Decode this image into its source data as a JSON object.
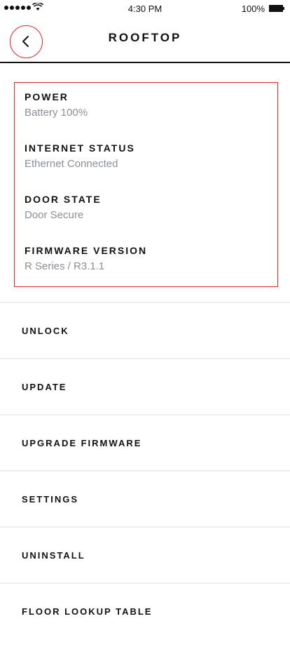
{
  "status_bar": {
    "time": "4:30 PM",
    "battery": "100%"
  },
  "header": {
    "title": "ROOFTOP",
    "back_icon": "chevron-left-icon"
  },
  "info": {
    "items": [
      {
        "label": "POWER",
        "value": "Battery 100%"
      },
      {
        "label": "INTERNET STATUS",
        "value": "Ethernet Connected"
      },
      {
        "label": "DOOR STATE",
        "value": "Door Secure"
      },
      {
        "label": "FIRMWARE VERSION",
        "value": "R Series / R3.1.1"
      }
    ]
  },
  "menu": {
    "items": [
      {
        "label": "UNLOCK"
      },
      {
        "label": "UPDATE"
      },
      {
        "label": "UPGRADE FIRMWARE"
      },
      {
        "label": "SETTINGS"
      },
      {
        "label": "UNINSTALL"
      },
      {
        "label": "FLOOR LOOKUP TABLE"
      }
    ]
  },
  "colors": {
    "accent": "#e0252b",
    "value_text": "#8a8f95",
    "divider": "#eeeeee"
  }
}
